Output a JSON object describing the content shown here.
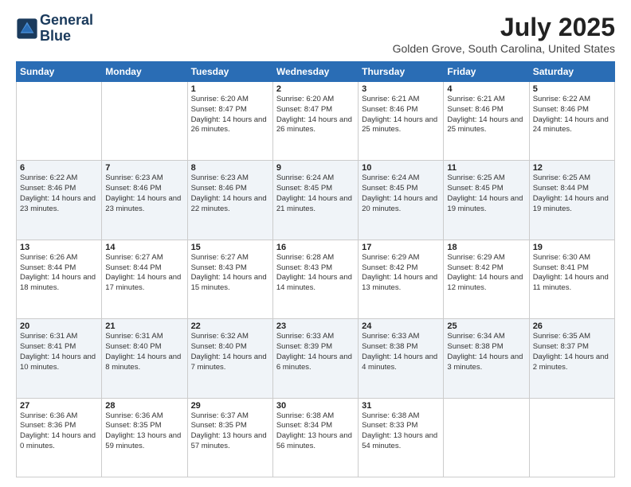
{
  "header": {
    "logo_line1": "General",
    "logo_line2": "Blue",
    "month_year": "July 2025",
    "location": "Golden Grove, South Carolina, United States"
  },
  "days_of_week": [
    "Sunday",
    "Monday",
    "Tuesday",
    "Wednesday",
    "Thursday",
    "Friday",
    "Saturday"
  ],
  "weeks": [
    [
      {
        "day": "",
        "info": ""
      },
      {
        "day": "",
        "info": ""
      },
      {
        "day": "1",
        "info": "Sunrise: 6:20 AM\nSunset: 8:47 PM\nDaylight: 14 hours and 26 minutes."
      },
      {
        "day": "2",
        "info": "Sunrise: 6:20 AM\nSunset: 8:47 PM\nDaylight: 14 hours and 26 minutes."
      },
      {
        "day": "3",
        "info": "Sunrise: 6:21 AM\nSunset: 8:46 PM\nDaylight: 14 hours and 25 minutes."
      },
      {
        "day": "4",
        "info": "Sunrise: 6:21 AM\nSunset: 8:46 PM\nDaylight: 14 hours and 25 minutes."
      },
      {
        "day": "5",
        "info": "Sunrise: 6:22 AM\nSunset: 8:46 PM\nDaylight: 14 hours and 24 minutes."
      }
    ],
    [
      {
        "day": "6",
        "info": "Sunrise: 6:22 AM\nSunset: 8:46 PM\nDaylight: 14 hours and 23 minutes."
      },
      {
        "day": "7",
        "info": "Sunrise: 6:23 AM\nSunset: 8:46 PM\nDaylight: 14 hours and 23 minutes."
      },
      {
        "day": "8",
        "info": "Sunrise: 6:23 AM\nSunset: 8:46 PM\nDaylight: 14 hours and 22 minutes."
      },
      {
        "day": "9",
        "info": "Sunrise: 6:24 AM\nSunset: 8:45 PM\nDaylight: 14 hours and 21 minutes."
      },
      {
        "day": "10",
        "info": "Sunrise: 6:24 AM\nSunset: 8:45 PM\nDaylight: 14 hours and 20 minutes."
      },
      {
        "day": "11",
        "info": "Sunrise: 6:25 AM\nSunset: 8:45 PM\nDaylight: 14 hours and 19 minutes."
      },
      {
        "day": "12",
        "info": "Sunrise: 6:25 AM\nSunset: 8:44 PM\nDaylight: 14 hours and 19 minutes."
      }
    ],
    [
      {
        "day": "13",
        "info": "Sunrise: 6:26 AM\nSunset: 8:44 PM\nDaylight: 14 hours and 18 minutes."
      },
      {
        "day": "14",
        "info": "Sunrise: 6:27 AM\nSunset: 8:44 PM\nDaylight: 14 hours and 17 minutes."
      },
      {
        "day": "15",
        "info": "Sunrise: 6:27 AM\nSunset: 8:43 PM\nDaylight: 14 hours and 15 minutes."
      },
      {
        "day": "16",
        "info": "Sunrise: 6:28 AM\nSunset: 8:43 PM\nDaylight: 14 hours and 14 minutes."
      },
      {
        "day": "17",
        "info": "Sunrise: 6:29 AM\nSunset: 8:42 PM\nDaylight: 14 hours and 13 minutes."
      },
      {
        "day": "18",
        "info": "Sunrise: 6:29 AM\nSunset: 8:42 PM\nDaylight: 14 hours and 12 minutes."
      },
      {
        "day": "19",
        "info": "Sunrise: 6:30 AM\nSunset: 8:41 PM\nDaylight: 14 hours and 11 minutes."
      }
    ],
    [
      {
        "day": "20",
        "info": "Sunrise: 6:31 AM\nSunset: 8:41 PM\nDaylight: 14 hours and 10 minutes."
      },
      {
        "day": "21",
        "info": "Sunrise: 6:31 AM\nSunset: 8:40 PM\nDaylight: 14 hours and 8 minutes."
      },
      {
        "day": "22",
        "info": "Sunrise: 6:32 AM\nSunset: 8:40 PM\nDaylight: 14 hours and 7 minutes."
      },
      {
        "day": "23",
        "info": "Sunrise: 6:33 AM\nSunset: 8:39 PM\nDaylight: 14 hours and 6 minutes."
      },
      {
        "day": "24",
        "info": "Sunrise: 6:33 AM\nSunset: 8:38 PM\nDaylight: 14 hours and 4 minutes."
      },
      {
        "day": "25",
        "info": "Sunrise: 6:34 AM\nSunset: 8:38 PM\nDaylight: 14 hours and 3 minutes."
      },
      {
        "day": "26",
        "info": "Sunrise: 6:35 AM\nSunset: 8:37 PM\nDaylight: 14 hours and 2 minutes."
      }
    ],
    [
      {
        "day": "27",
        "info": "Sunrise: 6:36 AM\nSunset: 8:36 PM\nDaylight: 14 hours and 0 minutes."
      },
      {
        "day": "28",
        "info": "Sunrise: 6:36 AM\nSunset: 8:35 PM\nDaylight: 13 hours and 59 minutes."
      },
      {
        "day": "29",
        "info": "Sunrise: 6:37 AM\nSunset: 8:35 PM\nDaylight: 13 hours and 57 minutes."
      },
      {
        "day": "30",
        "info": "Sunrise: 6:38 AM\nSunset: 8:34 PM\nDaylight: 13 hours and 56 minutes."
      },
      {
        "day": "31",
        "info": "Sunrise: 6:38 AM\nSunset: 8:33 PM\nDaylight: 13 hours and 54 minutes."
      },
      {
        "day": "",
        "info": ""
      },
      {
        "day": "",
        "info": ""
      }
    ]
  ]
}
